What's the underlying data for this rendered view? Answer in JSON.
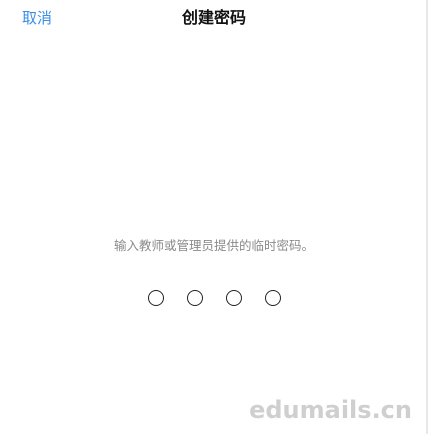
{
  "nav": {
    "cancel_label": "取消",
    "title": "创建密码"
  },
  "instruction": "输入教师或管理员提供的临时密码。",
  "passcode": {
    "length": 4,
    "entered": 0
  },
  "watermark": "edumails.cn"
}
